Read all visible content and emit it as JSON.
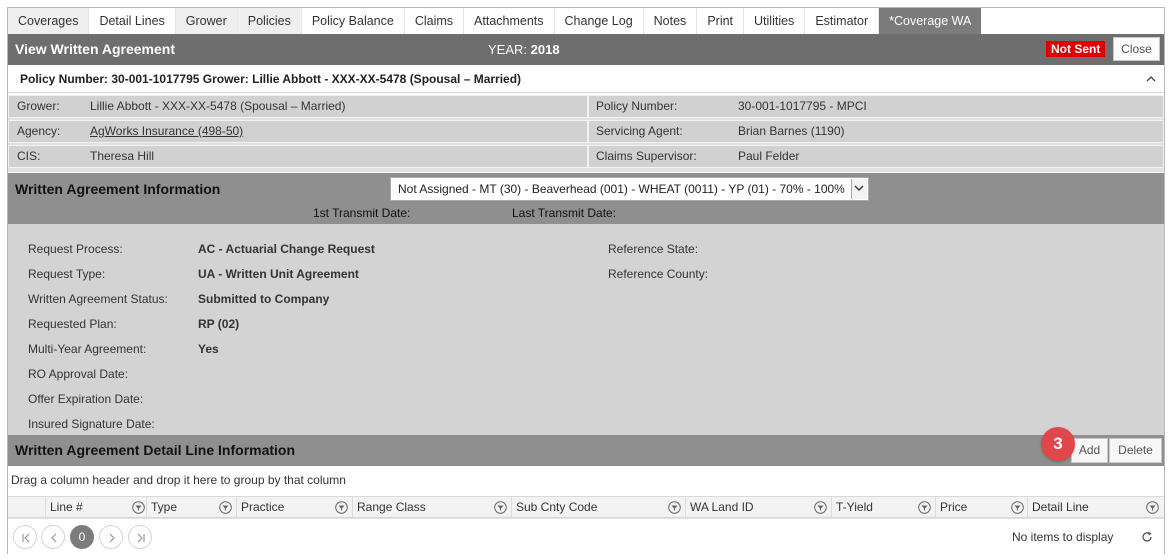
{
  "tabs": [
    {
      "label": "Coverages",
      "style": "gray"
    },
    {
      "label": "Detail Lines",
      "style": "normal"
    },
    {
      "label": "Grower",
      "style": "gray"
    },
    {
      "label": "Policies",
      "style": "gray"
    },
    {
      "label": "Policy Balance",
      "style": "normal"
    },
    {
      "label": "Claims",
      "style": "normal"
    },
    {
      "label": "Attachments",
      "style": "normal"
    },
    {
      "label": "Change Log",
      "style": "normal"
    },
    {
      "label": "Notes",
      "style": "normal"
    },
    {
      "label": "Print",
      "style": "normal"
    },
    {
      "label": "Utilities",
      "style": "normal"
    },
    {
      "label": "Estimator",
      "style": "normal"
    },
    {
      "label": "*Coverage WA",
      "style": "active"
    }
  ],
  "header": {
    "title": "View Written Agreement",
    "year_label": "YEAR:",
    "year_value": "2018",
    "status": "Not Sent",
    "status_color": "#e00000",
    "close_label": "Close"
  },
  "policy_line": "Policy Number: 30-001-1017795 Grower: Lillie Abbott - XXX-XX-5478 (Spousal – Married)",
  "info": {
    "grower_label": "Grower:",
    "grower_value": "Lillie Abbott - XXX-XX-5478 (Spousal – Married)",
    "agency_label": "Agency:",
    "agency_value": "AgWorks Insurance (498-50)",
    "cis_label": "CIS:",
    "cis_value": "Theresa Hill",
    "policy_number_label": "Policy Number:",
    "policy_number_value": "30-001-1017795 - MPCI",
    "servicing_agent_label": "Servicing Agent:",
    "servicing_agent_value": "Brian Barnes (1190)",
    "claims_supervisor_label": "Claims Supervisor:",
    "claims_supervisor_value": "Paul Felder"
  },
  "wa": {
    "title": "Written Agreement Information",
    "selected": "Not Assigned - MT (30) - Beaverhead (001) - WHEAT (0011) - YP (01) - 70% - 100%",
    "first_transmit_label": "1st Transmit Date:",
    "last_transmit_label": "Last Transmit Date:"
  },
  "details": {
    "request_process_label": "Request Process:",
    "request_process_value": "AC - Actuarial Change Request",
    "request_type_label": "Request Type:",
    "request_type_value": "UA - Written Unit Agreement",
    "status_label": "Written Agreement Status:",
    "status_value": "Submitted to Company",
    "requested_plan_label": "Requested Plan:",
    "requested_plan_value": "RP (02)",
    "multi_year_label": "Multi-Year Agreement:",
    "multi_year_value": "Yes",
    "ro_approval_label": "RO Approval Date:",
    "offer_expiration_label": "Offer Expiration Date:",
    "insured_signature_label": "Insured Signature Date:",
    "reference_state_label": "Reference State:",
    "reference_county_label": "Reference County:"
  },
  "detail_lines": {
    "title": "Written Agreement Detail Line Information",
    "add_label": "Add",
    "delete_label": "Delete",
    "step_badge": "3",
    "group_hint": "Drag a column header and drop it here to group by that column",
    "columns": [
      "Line #",
      "Type",
      "Practice",
      "Range Class",
      "Sub Cnty Code",
      "WA Land ID",
      "T-Yield",
      "Price",
      "Detail Line"
    ],
    "current_page": "0",
    "no_items": "No items to display"
  }
}
